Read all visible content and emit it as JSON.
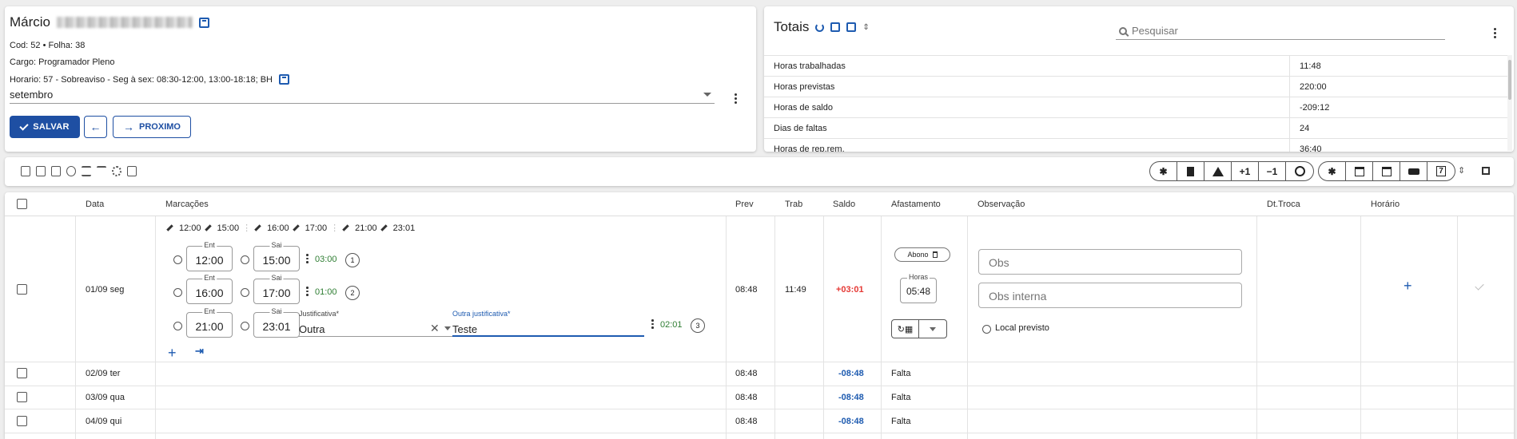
{
  "employee": {
    "first_name": "Márcio",
    "cod_folha": "Cod: 52 • Folha: 38",
    "cargo": "Cargo: Programador Pleno",
    "horario": "Horario: 57 - Sobreaviso - Seg à sex: 08:30-12:00, 13:00-18:18; BH",
    "month": "setembro",
    "save_label": "SALVAR",
    "next_label": "PROXIMO"
  },
  "totals": {
    "title": "Totais",
    "search_placeholder": "Pesquisar",
    "rows": [
      {
        "label": "Horas trabalhadas",
        "value": "11:48"
      },
      {
        "label": "Horas previstas",
        "value": "220:00"
      },
      {
        "label": "Horas de saldo",
        "value": "-209:12"
      },
      {
        "label": "Dias de faltas",
        "value": "24"
      },
      {
        "label": "Horas de rep.rem.",
        "value": "36:40"
      }
    ]
  },
  "toolbar": {
    "group1": [
      "*",
      "bookmark",
      "warning",
      "+1",
      "−1",
      "block"
    ],
    "group2": [
      "*",
      "calendar-x",
      "calendar",
      "bed",
      "7"
    ]
  },
  "grid": {
    "headers": {
      "data": "Data",
      "marcacoes": "Marcações",
      "prev": "Prev",
      "trab": "Trab",
      "saldo": "Saldo",
      "afastamento": "Afastamento",
      "observacao": "Observação",
      "dt_troca": "Dt.Troca",
      "horario": "Horário"
    },
    "expanded_row": {
      "date": "01/09 seg",
      "punches_summary": [
        "12:00",
        "15:00",
        "16:00",
        "17:00",
        "21:00",
        "23:01"
      ],
      "pairs": [
        {
          "ent_label": "Ent",
          "ent": "12:00",
          "sai_label": "Sai",
          "sai": "15:00",
          "dur": "03:00",
          "n": "1"
        },
        {
          "ent_label": "Ent",
          "ent": "16:00",
          "sai_label": "Sai",
          "sai": "17:00",
          "dur": "01:00",
          "n": "2"
        },
        {
          "ent_label": "Ent",
          "ent": "21:00",
          "sai_label": "Sai",
          "sai": "23:01",
          "dur": "02:01",
          "n": "3"
        }
      ],
      "justificativa_label": "Justificativa*",
      "justificativa_value": "Outra",
      "outra_label": "Outra justificativa*",
      "outra_value": "Teste",
      "prev": "08:48",
      "trab": "11:49",
      "saldo": "+03:01",
      "abono_label": "Abono",
      "horas_label": "Horas",
      "horas_value": "05:48",
      "obs_placeholder": "Obs",
      "obs_interna_placeholder": "Obs interna",
      "local_previsto": "Local previsto"
    },
    "rows": [
      {
        "date": "02/09 ter",
        "prev": "08:48",
        "saldo": "-08:48",
        "afast": "Falta"
      },
      {
        "date": "03/09 qua",
        "prev": "08:48",
        "saldo": "-08:48",
        "afast": "Falta"
      },
      {
        "date": "04/09 qui",
        "prev": "08:48",
        "saldo": "-08:48",
        "afast": "Falta"
      }
    ]
  }
}
